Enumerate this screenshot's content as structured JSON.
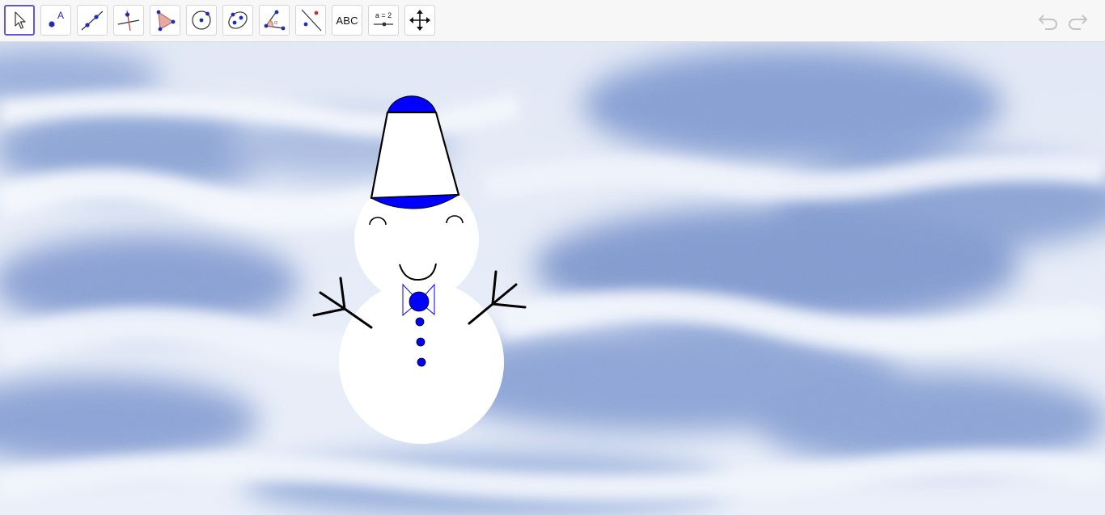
{
  "toolbar": {
    "tools": [
      {
        "name": "move-tool",
        "icon": "cursor-arrow-icon",
        "active": true
      },
      {
        "name": "point-tool",
        "icon": "point-with-label-icon"
      },
      {
        "name": "line-tool",
        "icon": "line-through-two-points-icon"
      },
      {
        "name": "perpendicular-line-tool",
        "icon": "perpendicular-line-icon"
      },
      {
        "name": "polygon-tool",
        "icon": "polygon-icon"
      },
      {
        "name": "circle-tool",
        "icon": "circle-center-point-icon"
      },
      {
        "name": "ellipse-tool",
        "icon": "ellipse-icon"
      },
      {
        "name": "angle-tool",
        "icon": "angle-icon"
      },
      {
        "name": "reflect-tool",
        "icon": "reflect-about-line-icon"
      },
      {
        "name": "text-tool",
        "icon": "text-icon",
        "label": "ABC"
      },
      {
        "name": "slider-tool",
        "icon": "slider-icon",
        "label": "a = 2"
      },
      {
        "name": "move-graphics-view-tool",
        "icon": "move-graphics-view-icon"
      }
    ],
    "undo_icon": "undo-icon",
    "redo_icon": "redo-icon"
  },
  "colors": {
    "accent": "#6557d2",
    "toolbar_bg": "#f7f7f7",
    "snow_light": "#e9eef8",
    "snow_shadow": "#6e8fca",
    "snowman_white": "#ffffff",
    "hat_blue": "#0000ff",
    "ink": "#000000"
  }
}
